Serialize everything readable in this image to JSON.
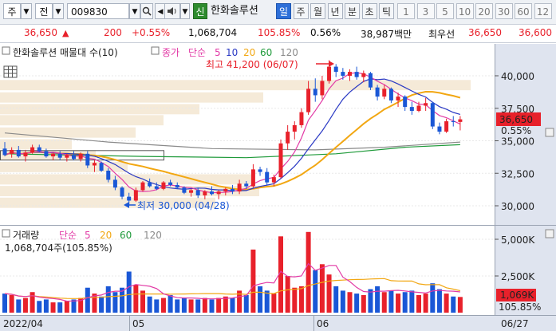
{
  "toolbar": {
    "type_select": "주",
    "search_type": "전",
    "code": "009830",
    "name": "한화솔루션",
    "signal_badge": "신",
    "periods": [
      "일",
      "주",
      "월",
      "년",
      "분",
      "초",
      "틱"
    ],
    "active_period": "일",
    "intervals": [
      "1",
      "3",
      "5",
      "10",
      "20",
      "30",
      "60",
      "12"
    ]
  },
  "quote": {
    "price": "36,650",
    "change_arrow": "▲",
    "change": "200",
    "change_pct": "+0.55%",
    "volume": "1,068,704",
    "volume_ratio": "105.85%",
    "turnover": "0.56%",
    "trade_value": "38,987백만",
    "high_label": "최우선",
    "bid": "36,650",
    "ask": "36,600"
  },
  "price_panel": {
    "legend_title": "한화솔루션 매물대 수(10)",
    "legend_close": "종가",
    "legend_ma_label": "단순",
    "legend_ma_periods": [
      "5",
      "10",
      "20",
      "60",
      "120"
    ],
    "high_note": "최고 41,200 (06/07)",
    "low_note": "최저 30,000 (04/28)",
    "current_price_tag": "36,650",
    "current_pct_tag": "0.55%",
    "y_ticks": [
      "40,000",
      "37,500",
      "35,000",
      "32,500",
      "30,000"
    ],
    "colors": {
      "up": "#e8212b",
      "down": "#1a57d6",
      "ma5": "#e23aa6",
      "ma10": "#2a39c4",
      "ma20": "#f2a712",
      "ma60": "#1f9a3a",
      "ma120": "#8a8a8a"
    }
  },
  "volume_panel": {
    "legend_title": "거래량",
    "legend_ma_label": "단순",
    "legend_ma_periods": [
      "5",
      "20",
      "60",
      "120"
    ],
    "current_volume_text": "1,068,704주(105.85%)",
    "y_ticks": [
      "5,000K",
      "2,500K"
    ],
    "current_volume_tag": "1,069K",
    "current_pct_tag": "105.85%"
  },
  "x_axis": {
    "labels": [
      "2022/04",
      "05",
      "06",
      "06/27"
    ]
  },
  "chart_data": {
    "type": "candlestick",
    "title": "한화솔루션",
    "ylim": [
      29200,
      41300
    ],
    "volume_ylim": [
      0,
      6000
    ],
    "volume_unit": "K",
    "candles": [
      {
        "o": 34400,
        "h": 34900,
        "l": 33800,
        "c": 33900,
        "v": 1300
      },
      {
        "o": 34000,
        "h": 34500,
        "l": 33700,
        "c": 34300,
        "v": 1200
      },
      {
        "o": 34300,
        "h": 34600,
        "l": 33700,
        "c": 33800,
        "v": 900
      },
      {
        "o": 33800,
        "h": 34300,
        "l": 33400,
        "c": 34100,
        "v": 1000
      },
      {
        "o": 34100,
        "h": 34700,
        "l": 34000,
        "c": 34500,
        "v": 1400
      },
      {
        "o": 34500,
        "h": 34700,
        "l": 34100,
        "c": 34200,
        "v": 800
      },
      {
        "o": 34200,
        "h": 34400,
        "l": 33700,
        "c": 33800,
        "v": 900
      },
      {
        "o": 33800,
        "h": 34100,
        "l": 33500,
        "c": 34000,
        "v": 700
      },
      {
        "o": 34000,
        "h": 34200,
        "l": 33500,
        "c": 33700,
        "v": 700
      },
      {
        "o": 33700,
        "h": 34000,
        "l": 33400,
        "c": 33900,
        "v": 800
      },
      {
        "o": 33900,
        "h": 34200,
        "l": 33500,
        "c": 33600,
        "v": 900
      },
      {
        "o": 33600,
        "h": 34100,
        "l": 33400,
        "c": 34000,
        "v": 1000
      },
      {
        "o": 34000,
        "h": 34200,
        "l": 32900,
        "c": 33100,
        "v": 1700
      },
      {
        "o": 33100,
        "h": 33500,
        "l": 32600,
        "c": 33300,
        "v": 1300
      },
      {
        "o": 33300,
        "h": 33400,
        "l": 32600,
        "c": 32700,
        "v": 1100
      },
      {
        "o": 32700,
        "h": 32900,
        "l": 31800,
        "c": 32000,
        "v": 1800
      },
      {
        "o": 32000,
        "h": 32300,
        "l": 31200,
        "c": 31400,
        "v": 1400
      },
      {
        "o": 31400,
        "h": 31500,
        "l": 30500,
        "c": 30700,
        "v": 1700
      },
      {
        "o": 30700,
        "h": 31000,
        "l": 30000,
        "c": 30400,
        "v": 2800
      },
      {
        "o": 30400,
        "h": 31400,
        "l": 30300,
        "c": 31200,
        "v": 1900
      },
      {
        "o": 31200,
        "h": 31900,
        "l": 31100,
        "c": 31800,
        "v": 1500
      },
      {
        "o": 31800,
        "h": 32100,
        "l": 31400,
        "c": 31500,
        "v": 1100
      },
      {
        "o": 31500,
        "h": 31800,
        "l": 31200,
        "c": 31300,
        "v": 900
      },
      {
        "o": 31300,
        "h": 31900,
        "l": 31200,
        "c": 31800,
        "v": 1000
      },
      {
        "o": 31800,
        "h": 32000,
        "l": 31500,
        "c": 31600,
        "v": 1200
      },
      {
        "o": 31600,
        "h": 31800,
        "l": 31300,
        "c": 31400,
        "v": 900
      },
      {
        "o": 31400,
        "h": 31500,
        "l": 30900,
        "c": 31000,
        "v": 1000
      },
      {
        "o": 31000,
        "h": 31300,
        "l": 30700,
        "c": 31200,
        "v": 900
      },
      {
        "o": 31200,
        "h": 31400,
        "l": 30600,
        "c": 30800,
        "v": 900
      },
      {
        "o": 30800,
        "h": 31200,
        "l": 30500,
        "c": 31100,
        "v": 1000
      },
      {
        "o": 31100,
        "h": 31500,
        "l": 30800,
        "c": 30900,
        "v": 900
      },
      {
        "o": 30900,
        "h": 31200,
        "l": 30500,
        "c": 31100,
        "v": 1000
      },
      {
        "o": 31100,
        "h": 31400,
        "l": 30800,
        "c": 31300,
        "v": 1100
      },
      {
        "o": 31300,
        "h": 31600,
        "l": 30900,
        "c": 31100,
        "v": 1000
      },
      {
        "o": 31100,
        "h": 32000,
        "l": 30900,
        "c": 31700,
        "v": 1500
      },
      {
        "o": 31700,
        "h": 31900,
        "l": 31300,
        "c": 31500,
        "v": 1200
      },
      {
        "o": 31500,
        "h": 33200,
        "l": 31400,
        "c": 32800,
        "v": 4300
      },
      {
        "o": 32800,
        "h": 33000,
        "l": 32300,
        "c": 32600,
        "v": 1800
      },
      {
        "o": 32600,
        "h": 32900,
        "l": 31600,
        "c": 31800,
        "v": 1500
      },
      {
        "o": 31800,
        "h": 32400,
        "l": 31500,
        "c": 32200,
        "v": 1300
      },
      {
        "o": 32200,
        "h": 35100,
        "l": 32100,
        "c": 34800,
        "v": 5200
      },
      {
        "o": 34800,
        "h": 36200,
        "l": 34300,
        "c": 35700,
        "v": 2500
      },
      {
        "o": 35700,
        "h": 36500,
        "l": 35100,
        "c": 36200,
        "v": 1700
      },
      {
        "o": 36200,
        "h": 37500,
        "l": 36000,
        "c": 37200,
        "v": 1800
      },
      {
        "o": 37200,
        "h": 39600,
        "l": 37000,
        "c": 39000,
        "v": 5500
      },
      {
        "o": 39000,
        "h": 39800,
        "l": 38000,
        "c": 38500,
        "v": 2900
      },
      {
        "o": 38500,
        "h": 40000,
        "l": 38200,
        "c": 39600,
        "v": 3300
      },
      {
        "o": 39600,
        "h": 41200,
        "l": 39400,
        "c": 40700,
        "v": 2600
      },
      {
        "o": 40700,
        "h": 40900,
        "l": 39900,
        "c": 40300,
        "v": 1800
      },
      {
        "o": 40300,
        "h": 40600,
        "l": 39700,
        "c": 40000,
        "v": 1500
      },
      {
        "o": 40000,
        "h": 40500,
        "l": 39600,
        "c": 40300,
        "v": 1400
      },
      {
        "o": 40300,
        "h": 40700,
        "l": 39700,
        "c": 39900,
        "v": 1300
      },
      {
        "o": 39900,
        "h": 40400,
        "l": 39500,
        "c": 40200,
        "v": 1200
      },
      {
        "o": 40200,
        "h": 40300,
        "l": 38900,
        "c": 39100,
        "v": 1600
      },
      {
        "o": 39100,
        "h": 39300,
        "l": 38100,
        "c": 38400,
        "v": 1800
      },
      {
        "o": 38400,
        "h": 39300,
        "l": 38200,
        "c": 39000,
        "v": 1400
      },
      {
        "o": 39000,
        "h": 39100,
        "l": 37900,
        "c": 38100,
        "v": 1500
      },
      {
        "o": 38100,
        "h": 38700,
        "l": 37600,
        "c": 38400,
        "v": 1300
      },
      {
        "o": 38400,
        "h": 38500,
        "l": 37300,
        "c": 37600,
        "v": 1400
      },
      {
        "o": 37600,
        "h": 38000,
        "l": 37000,
        "c": 37300,
        "v": 1500
      },
      {
        "o": 37300,
        "h": 38000,
        "l": 37200,
        "c": 37700,
        "v": 1200
      },
      {
        "o": 37700,
        "h": 38300,
        "l": 37300,
        "c": 37900,
        "v": 1300
      },
      {
        "o": 37900,
        "h": 38000,
        "l": 35900,
        "c": 36100,
        "v": 2000
      },
      {
        "o": 36100,
        "h": 36400,
        "l": 35500,
        "c": 35700,
        "v": 1600
      },
      {
        "o": 35700,
        "h": 36700,
        "l": 35600,
        "c": 36500,
        "v": 1300
      },
      {
        "o": 36500,
        "h": 36900,
        "l": 36100,
        "c": 36450,
        "v": 1100
      },
      {
        "o": 36450,
        "h": 36900,
        "l": 35800,
        "c": 36650,
        "v": 1069
      }
    ]
  }
}
